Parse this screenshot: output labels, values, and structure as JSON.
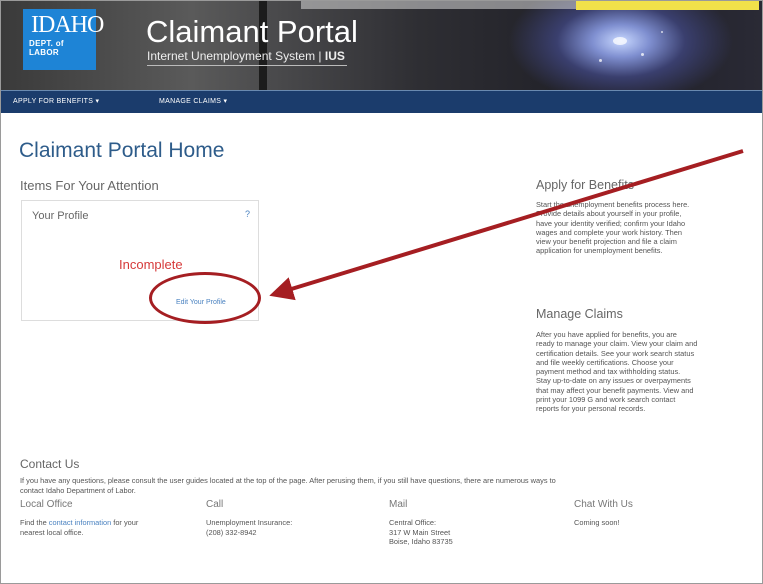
{
  "header": {
    "logo_top": "IDAHO",
    "logo_bottom": "DEPT. of LABOR",
    "title": "Claimant Portal",
    "subtitle": "Internet Unemployment System | ",
    "subtitle_mark": "IUS"
  },
  "nav": {
    "items": [
      {
        "label": "APPLY FOR BENEFITS ▾"
      },
      {
        "label": "MANAGE CLAIMS ▾"
      }
    ]
  },
  "page": {
    "title": "Claimant Portal Home"
  },
  "attention": {
    "title": "Items For Your Attention",
    "card": {
      "title": "Your Profile",
      "help": "?",
      "status": "Incomplete",
      "status_color": "#d63a3a",
      "edit_link": "Edit Your Profile"
    }
  },
  "apply": {
    "title": "Apply for Benefits",
    "lines": [
      "Start the unemployment benefits process here.",
      "Provide details about yourself in your profile,",
      "have your identity verified; confirm your Idaho",
      "wages and complete your work history. Then",
      "view your benefit projection and file a claim",
      "application for unemployment benefits."
    ]
  },
  "manage": {
    "title": "Manage Claims",
    "lines": [
      "After you have applied for benefits, you are",
      "ready to manage your claim. View your claim and",
      "certification details. See your work search status",
      "and file weekly certifications. Choose your",
      "payment method and tax withholding status.",
      "Stay up-to-date on any issues or overpayments",
      "that may affect your benefit payments. View and",
      "print your 1099 G and work search contact",
      "reports for your personal records."
    ]
  },
  "contact": {
    "title": "Contact Us",
    "text_line1": "If you have any questions, please consult the user guides located at the top of the page. After perusing them, if you still have questions, there are numerous ways to",
    "text_line2": "contact Idaho Department of Labor.",
    "local": {
      "heading": "Local Office",
      "pre": "Find the ",
      "link": "contact information",
      "post": " for your",
      "line2": "nearest local office."
    },
    "call": {
      "heading": "Call",
      "line1": "Unemployment Insurance:",
      "line2": "(208) 332-8942"
    },
    "mail": {
      "heading": "Mail",
      "line1": "Central Office:",
      "line2": "317 W Main Street",
      "line3": "Boise, Idaho 83735"
    },
    "chat": {
      "heading": "Chat With Us",
      "line1": "Coming soon!"
    }
  },
  "annotation_color": "#a51e22"
}
